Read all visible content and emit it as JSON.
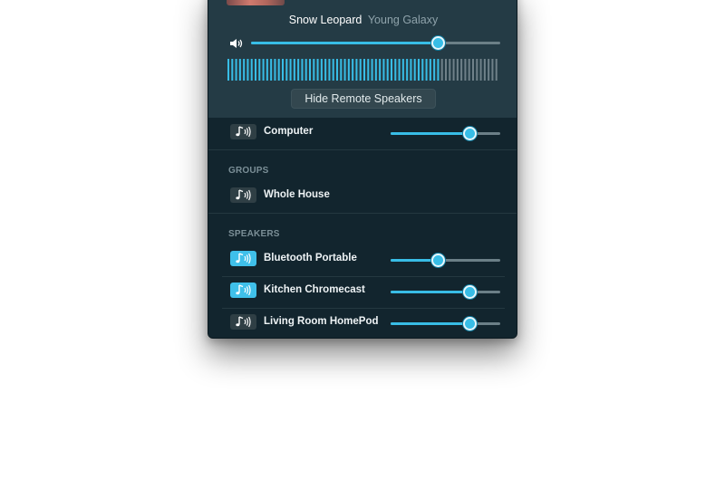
{
  "now_playing": {
    "title": "Snow Leopard",
    "artist": "Young Galaxy",
    "master_volume": 0.75,
    "level_meter": 0.79,
    "hide_button_label": "Hide Remote Speakers"
  },
  "computer": {
    "label": "Computer",
    "volume": 0.72,
    "active": false
  },
  "groups": {
    "heading": "GROUPS",
    "items": [
      {
        "label": "Whole House",
        "active": false
      }
    ]
  },
  "speakers": {
    "heading": "SPEAKERS",
    "items": [
      {
        "label": "Bluetooth Portable",
        "volume": 0.43,
        "active": true
      },
      {
        "label": "Kitchen Chromecast",
        "volume": 0.72,
        "active": true
      },
      {
        "label": "Living Room HomePod",
        "volume": 0.72,
        "active": false
      }
    ]
  },
  "colors": {
    "accent": "#38bde6",
    "panel_bg": "#12252e",
    "header_bg": "#243b45"
  },
  "icons": {
    "volume": "speaker-volume-icon",
    "device": "music-note-airplay-icon"
  }
}
